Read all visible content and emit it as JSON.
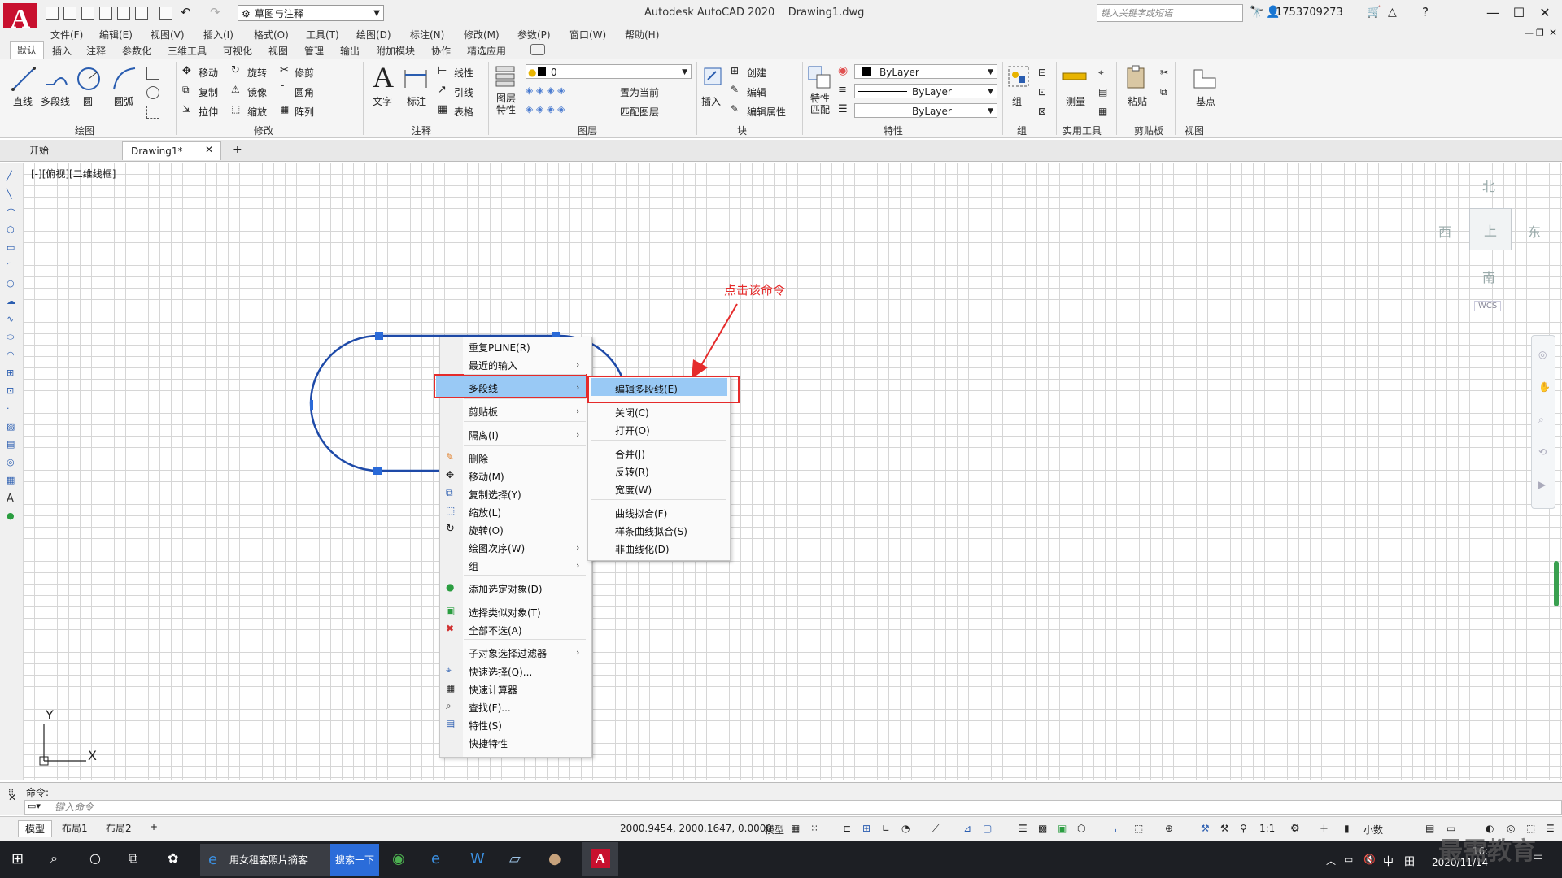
{
  "titlebar": {
    "workspace": "草图与注释",
    "title": "Autodesk AutoCAD 2020",
    "document": "Drawing1.dwg",
    "search_placeholder": "键入关键字或短语",
    "user": "1753709273"
  },
  "menubar": [
    "文件(F)",
    "编辑(E)",
    "视图(V)",
    "插入(I)",
    "格式(O)",
    "工具(T)",
    "绘图(D)",
    "标注(N)",
    "修改(M)",
    "参数(P)",
    "窗口(W)",
    "帮助(H)"
  ],
  "ribbon_tabs": [
    "默认",
    "插入",
    "注释",
    "参数化",
    "三维工具",
    "可视化",
    "视图",
    "管理",
    "输出",
    "附加模块",
    "协作",
    "精选应用"
  ],
  "ribbon": {
    "draw": {
      "title": "绘图",
      "line": "直线",
      "polyline": "多段线",
      "circle": "圆",
      "arc": "圆弧"
    },
    "modify": {
      "title": "修改",
      "move": "移动",
      "rotate": "旋转",
      "trim": "修剪",
      "copy": "复制",
      "mirror": "镜像",
      "fillet": "圆角",
      "stretch": "拉伸",
      "scale": "缩放",
      "array": "阵列"
    },
    "annotation": {
      "title": "注释",
      "text": "文字",
      "dimension": "标注",
      "linear": "线性",
      "leader": "引线",
      "table": "表格"
    },
    "layers": {
      "title": "图层",
      "layer_props": "图层特性",
      "layer_value": "0",
      "set_current": "置为当前",
      "match_layer": "匹配图层"
    },
    "block": {
      "title": "块",
      "insert": "插入",
      "create": "创建",
      "edit": "编辑",
      "edit_attr": "编辑属性"
    },
    "properties": {
      "title": "特性",
      "match": "特性匹配",
      "color": "ByLayer",
      "linetype": "ByLayer",
      "lineweight": "ByLayer"
    },
    "groups": {
      "title": "组",
      "group": "组"
    },
    "utilities": {
      "title": "实用工具",
      "measure": "测量"
    },
    "clipboard": {
      "title": "剪贴板",
      "paste": "粘贴"
    },
    "view": {
      "title": "视图",
      "base": "基点"
    }
  },
  "doc_tabs": {
    "start": "开始",
    "drawing": "Drawing1*",
    "add": "+"
  },
  "viewport_label": "[-][俯视][二维线框]",
  "viewcube": {
    "north": "北",
    "south": "南",
    "east": "东",
    "west": "西",
    "top": "上",
    "wcs": "WCS"
  },
  "axis": {
    "x": "X",
    "y": "Y"
  },
  "annotation_text": "点击该命令",
  "context_menu": {
    "items": [
      {
        "label": "重复PLINE(R)"
      },
      {
        "label": "最近的输入"
      },
      {
        "label": "多段线"
      },
      {
        "label": "剪贴板"
      },
      {
        "label": "隔离(I)"
      },
      {
        "label": "删除"
      },
      {
        "label": "移动(M)"
      },
      {
        "label": "复制选择(Y)"
      },
      {
        "label": "缩放(L)"
      },
      {
        "label": "旋转(O)"
      },
      {
        "label": "绘图次序(W)"
      },
      {
        "label": "组"
      },
      {
        "label": "添加选定对象(D)"
      },
      {
        "label": "选择类似对象(T)"
      },
      {
        "label": "全部不选(A)"
      },
      {
        "label": "子对象选择过滤器"
      },
      {
        "label": "快速选择(Q)..."
      },
      {
        "label": "快速计算器"
      },
      {
        "label": "查找(F)..."
      },
      {
        "label": "特性(S)"
      },
      {
        "label": "快捷特性"
      }
    ]
  },
  "submenu": {
    "items": [
      {
        "label": "编辑多段线(E)"
      },
      {
        "label": "关闭(C)"
      },
      {
        "label": "打开(O)"
      },
      {
        "label": "合并(J)"
      },
      {
        "label": "反转(R)"
      },
      {
        "label": "宽度(W)"
      },
      {
        "label": "曲线拟合(F)"
      },
      {
        "label": "样条曲线拟合(S)"
      },
      {
        "label": "非曲线化(D)"
      }
    ]
  },
  "command": {
    "prompt": "命令:",
    "placeholder": "键入命令"
  },
  "model_tabs": [
    "模型",
    "布局1",
    "布局2",
    "+"
  ],
  "status": {
    "coords": "2000.9454, 2000.1647, 0.0000",
    "model": "模型",
    "scale": "1:1",
    "units": "小数"
  },
  "taskbar": {
    "app_title": "用女租客照片摘客",
    "search_button": "搜索一下",
    "time": "16:",
    "date": "2020/11/14"
  },
  "watermark": "最需教育"
}
